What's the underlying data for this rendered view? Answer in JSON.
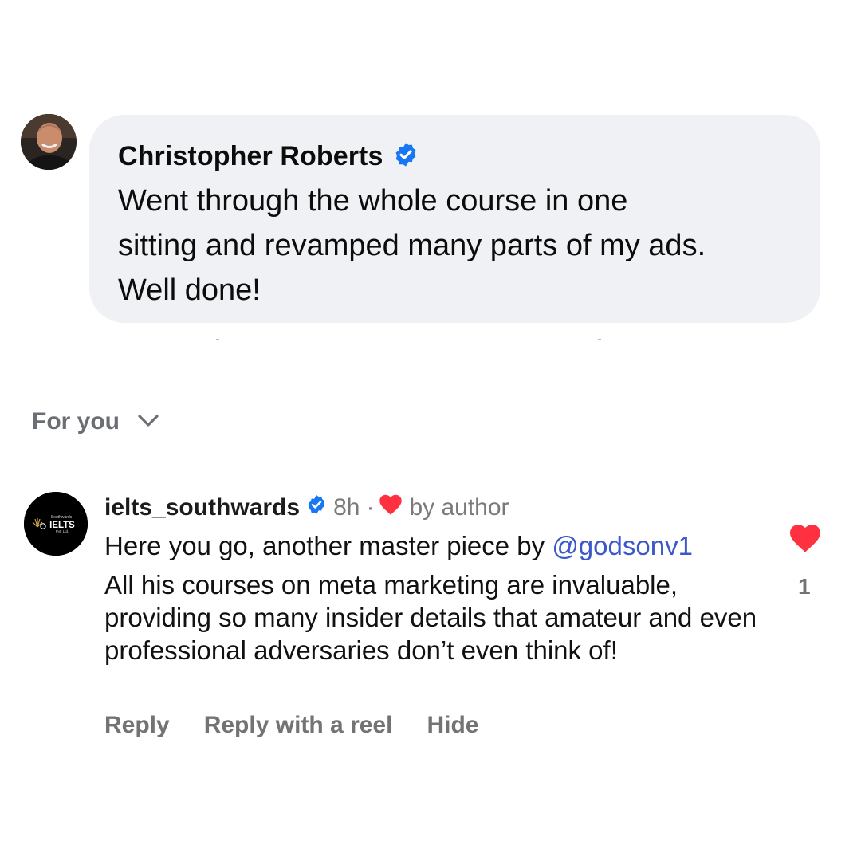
{
  "facebook_comment": {
    "author": "Christopher Roberts",
    "text": "Went through the whole course in one\nsitting and revamped many parts of my ads.\nWell done!"
  },
  "sort": {
    "label": "For you"
  },
  "instagram_comment": {
    "avatar": {
      "line1": "Southwards",
      "line2": "IELTS",
      "line3": "Pvt. Ltd."
    },
    "username": "ielts_southwards",
    "time": "8h",
    "separator": "·",
    "liked_by": "by author",
    "line1": "Here you go, another master piece by",
    "mention": "@godsonv1",
    "body": "All his courses on meta marketing are invaluable, providing so many insider details that amateur and even professional adversaries don’t even think of!",
    "like_count": "1",
    "actions": {
      "reply": "Reply",
      "reply_reel": "Reply with a reel",
      "hide": "Hide"
    }
  },
  "colors": {
    "bubble": "#f0f1f5",
    "verified": "#1877f2",
    "heart": "#ff3040",
    "mention": "#3a58c9",
    "secondary_text": "#737373"
  },
  "icons": [
    "verified-badge-icon",
    "chevron-down-icon",
    "heart-icon"
  ]
}
